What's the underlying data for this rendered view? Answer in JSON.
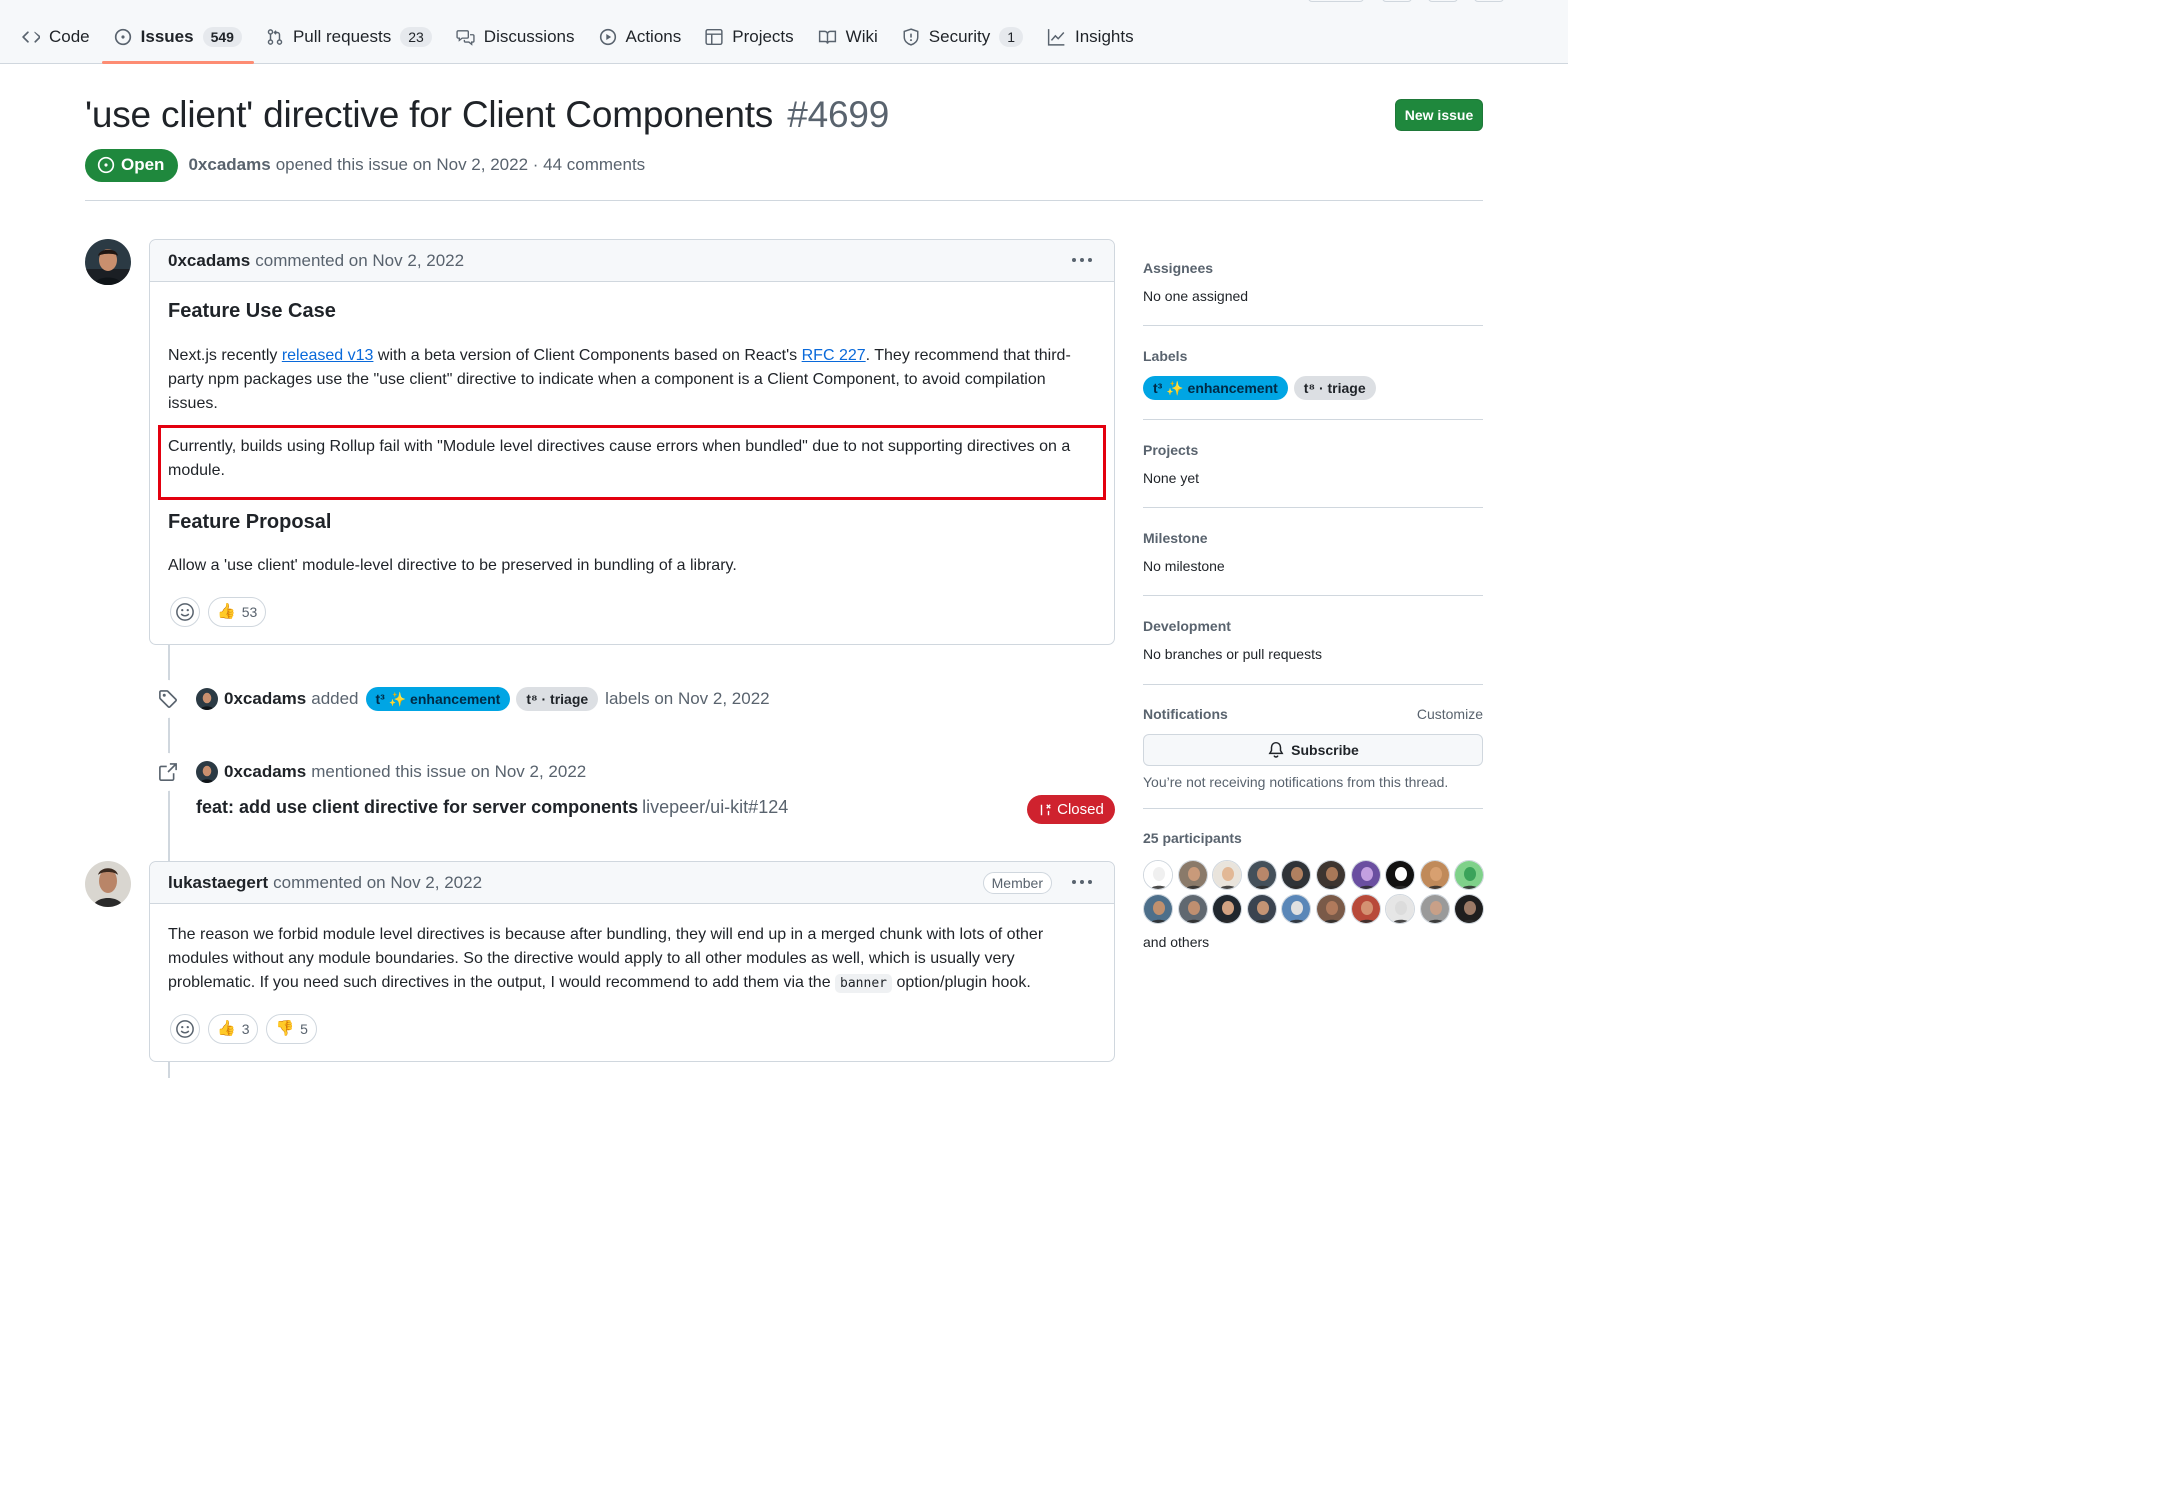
{
  "repo_nav": {
    "tabs": [
      {
        "label": "Code",
        "icon": "code-icon"
      },
      {
        "label": "Issues",
        "count": "549",
        "icon": "issue-opened-icon",
        "selected": true
      },
      {
        "label": "Pull requests",
        "count": "23",
        "icon": "git-pull-request-icon"
      },
      {
        "label": "Discussions",
        "icon": "comment-discussion-icon"
      },
      {
        "label": "Actions",
        "icon": "play-icon"
      },
      {
        "label": "Projects",
        "icon": "table-icon"
      },
      {
        "label": "Wiki",
        "icon": "book-icon"
      },
      {
        "label": "Security",
        "count": "1",
        "icon": "shield-icon"
      },
      {
        "label": "Insights",
        "icon": "graph-icon"
      }
    ]
  },
  "issue": {
    "title": "'use client' directive for Client Components",
    "number": "#4699",
    "new_issue_label": "New issue",
    "state": "Open",
    "author": "0xcadams",
    "meta_text": "opened this issue on Nov 2, 2022 · 44 comments"
  },
  "comments": [
    {
      "author": "0xcadams",
      "date_text": "commented on Nov 2, 2022",
      "heading1": "Feature Use Case",
      "p1_a": "Next.js recently ",
      "p1_link1": "released v13",
      "p1_b": " with a beta version of Client Components based on React's ",
      "p1_link2": "RFC 227",
      "p1_c": ". They recommend that third-party npm packages use the \"use client\" directive to indicate when a component is a Client Component, to avoid compilation issues.",
      "p2": "Currently, builds using Rollup fail with \"Module level directives cause errors when bundled\" due to not supporting directives on a module.",
      "heading2": "Feature Proposal",
      "p3": "Allow a 'use client' module-level directive to be preserved in bundling of a library.",
      "reactions": {
        "thumbs_up": "53"
      }
    },
    {
      "author": "lukastaegert",
      "date_text": "commented on Nov 2, 2022",
      "badge": "Member",
      "p1_a": "The reason we forbid module level directives is because after bundling, they will end up in a merged chunk with lots of other modules without any module boundaries. So the directive would apply to all other modules as well, which is usually very problematic. If you need such directives in the output, I would recommend to add them via the ",
      "p1_code": "banner",
      "p1_b": " option/plugin hook.",
      "reactions": {
        "thumbs_up": "3",
        "thumbs_down": "5"
      }
    }
  ],
  "events": {
    "labeled": {
      "author": "0xcadams",
      "verb": "added",
      "suffix": "labels on Nov 2, 2022"
    },
    "mentioned": {
      "author": "0xcadams",
      "text": "mentioned this issue on Nov 2, 2022",
      "ref_title": "feat: add use client directive for server components",
      "ref_repo": "livepeer/ui-kit#124",
      "ref_state": "Closed"
    }
  },
  "labels": {
    "enhancement": "t³ ✨ enhancement",
    "triage": "t⁸ · triage"
  },
  "sidebar": {
    "assignees": {
      "heading": "Assignees",
      "value": "No one assigned"
    },
    "labels_heading": "Labels",
    "projects": {
      "heading": "Projects",
      "value": "None yet"
    },
    "milestone": {
      "heading": "Milestone",
      "value": "No milestone"
    },
    "development": {
      "heading": "Development",
      "value": "No branches or pull requests"
    },
    "notifications": {
      "heading": "Notifications",
      "customize": "Customize",
      "subscribe_label": "Subscribe",
      "note": "You’re not receiving notifications from this thread."
    },
    "participants": {
      "heading": "25 participants",
      "more": "and others"
    }
  },
  "colors": {
    "open_green": "#1f883d",
    "closed_red": "#cf222e",
    "enhancement_label": "#00a5e4",
    "highlight_box": "#e3000f",
    "tab_underline": "#fd8c73"
  }
}
